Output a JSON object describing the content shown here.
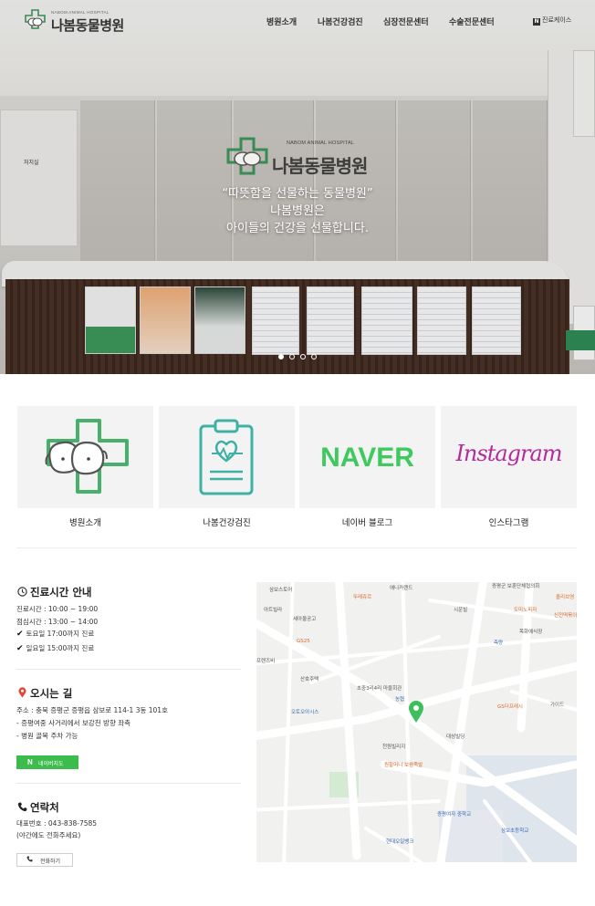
{
  "header": {
    "logo_sub": "NABOM ANIMAL HOSPITAL",
    "logo_text": "나봄동물병원",
    "nav": [
      "병원소개",
      "나봄건강검진",
      "심장전문센터",
      "수술전문센터"
    ],
    "naver_booking": "진료케이스",
    "naver_letter": "N"
  },
  "hero": {
    "room_sign": "처치실",
    "sign_sub": "NABOM ANIMAL HOSPITAL",
    "sign_text": "나봄동물병원",
    "quote_line1": "“따뜻함을 선물하는 동물병원”",
    "quote_line2": "나봄병원은",
    "quote_line3": "아이들의 건강을 선물합니다.",
    "slide_count": 4,
    "active_slide": 1
  },
  "tiles": [
    {
      "label": "병원소개",
      "icon": "hospital-logo-icon"
    },
    {
      "label": "나봄건강검진",
      "icon": "clipboard-heart-icon"
    },
    {
      "label": "네이버 블로그",
      "icon": "naver-logo",
      "word": "NAVER"
    },
    {
      "label": "인스타그램",
      "icon": "instagram-logo",
      "word": "Instagram"
    }
  ],
  "hours": {
    "title": "진료시간 안내",
    "icon": "clock-icon",
    "lines": [
      "진료시간 : 10:00 ~ 19:00",
      "점심시간 : 13:00 ~ 14:00"
    ],
    "checks": [
      "토요일 17:00까지 진료",
      "일요일 15:00까지 진료"
    ],
    "check_symbol": "✔"
  },
  "location": {
    "title": "오시는 길",
    "icon": "pin-icon",
    "lines": [
      "주소 : 충북 증평군 증평읍 삼보로 114-1 3동 101호",
      "- 증평여중 사거리에서 보강천 방향 좌측",
      "- 병원 골목 주차 가능"
    ],
    "button_letter": "N",
    "button_label": "네이버지도"
  },
  "contact": {
    "title": "연락처",
    "icon": "phone-icon",
    "lines": [
      "대표번호 : 043-838-7585",
      "(야간에도 전화주세요)"
    ],
    "button_label": "전화하기"
  },
  "map": {
    "labels": [
      {
        "text": "삼보스토어",
        "cls": ""
      },
      {
        "text": "애니카랜드",
        "cls": ""
      },
      {
        "text": "증평군 보훈단체협의회",
        "cls": ""
      },
      {
        "text": "뚜레쥬르",
        "cls": "orange"
      },
      {
        "text": "아트빌라",
        "cls": ""
      },
      {
        "text": "시운빌",
        "cls": ""
      },
      {
        "text": "도미노피자",
        "cls": "orange"
      },
      {
        "text": "올리브영",
        "cls": "orange"
      },
      {
        "text": "세아울공고",
        "cls": ""
      },
      {
        "text": "목화예식장",
        "cls": ""
      },
      {
        "text": "신전떡볶이",
        "cls": "orange"
      },
      {
        "text": "프렌즈비",
        "cls": ""
      },
      {
        "text": "GS25",
        "cls": "orange"
      },
      {
        "text": "측량",
        "cls": "blue"
      },
      {
        "text": "산호주택",
        "cls": ""
      },
      {
        "text": "초중3리4리 마을회관",
        "cls": ""
      },
      {
        "text": "농협",
        "cls": "blue"
      },
      {
        "text": "GS더프레시",
        "cls": "orange"
      },
      {
        "text": "가이드",
        "cls": ""
      },
      {
        "text": "오토오아시스",
        "cls": "blue"
      },
      {
        "text": "대성빌딩",
        "cls": ""
      },
      {
        "text": "천원빌리지",
        "cls": ""
      },
      {
        "text": "원할머니 보쌈족발",
        "cls": "orange"
      },
      {
        "text": "증평여자 중학교",
        "cls": "blue"
      },
      {
        "text": "삼보초등학교",
        "cls": "blue"
      },
      {
        "text": "현대오일뱅크",
        "cls": "blue"
      }
    ]
  }
}
